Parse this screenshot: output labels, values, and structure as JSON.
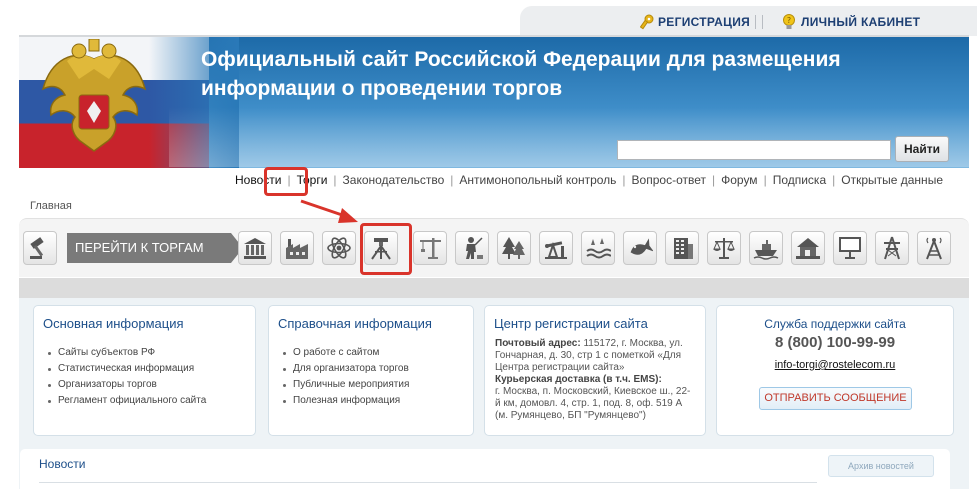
{
  "topbar": {
    "register": "РЕГИСТРАЦИЯ",
    "cabinet": "ЛИЧНЫЙ КАБИНЕТ"
  },
  "banner": {
    "title_line1": "Официальный сайт Российской Федерации для размещения",
    "title_line2": "информации о проведении торгов"
  },
  "search": {
    "value": "",
    "button": "Найти"
  },
  "nav": {
    "items": [
      "Новости",
      "Торги",
      "Законодательство",
      "Антимонопольный контроль",
      "Вопрос-ответ",
      "Форум",
      "Подписка",
      "Открытые данные"
    ]
  },
  "breadcrumb": "Главная",
  "iconbar": {
    "goto_label": "ПЕРЕЙТИ К ТОРГАМ",
    "icons": [
      "gavel-icon",
      "bank-building-icon",
      "factory-icon",
      "atom-icon",
      "surveyor-tripod-icon",
      "crane-icon",
      "hunter-icon",
      "forest-icon",
      "oil-pump-icon",
      "water-icon",
      "fish-icon",
      "apartment-building-icon",
      "justice-scales-icon",
      "ship-icon",
      "house-icon",
      "billboard-icon",
      "power-line-icon",
      "radio-tower-icon"
    ]
  },
  "info": {
    "basic": {
      "title": "Основная информация",
      "items": [
        "Сайты субъектов РФ",
        "Статистическая информация",
        "Организаторы торгов",
        "Регламент официального сайта"
      ]
    },
    "reference": {
      "title": "Справочная информация",
      "items": [
        "О работе с сайтом",
        "Для организатора торгов",
        "Публичные мероприятия",
        "Полезная информация"
      ]
    },
    "registration": {
      "title": "Центр регистрации сайта",
      "postal_label": "Почтовый адрес:",
      "postal_text": "115172, г. Москва, ул. Гончарная, д. 30, стр 1 с пометкой «Для Центра регистрации сайта»",
      "courier_label": "Курьерская доставка (в т.ч. EMS):",
      "courier_text": "г. Москва, п. Московский, Киевское ш., 22-й км, домовл. 4, стр. 1, под. 8, оф. 519 А (м. Румянцево, БП \"Румянцево\")"
    },
    "support": {
      "title": "Служба поддержки сайта",
      "phone": "8 (800) 100-99-99",
      "email": "info-torgi@rostelecom.ru",
      "button": "ОТПРАВИТЬ СООБЩЕНИЕ"
    }
  },
  "news": {
    "title": "Новости",
    "archive": "Архив новостей"
  },
  "colors": {
    "link_blue": "#1d4f8a",
    "highlight_red": "#d9342b",
    "banner_blue": "#2a79b8"
  }
}
